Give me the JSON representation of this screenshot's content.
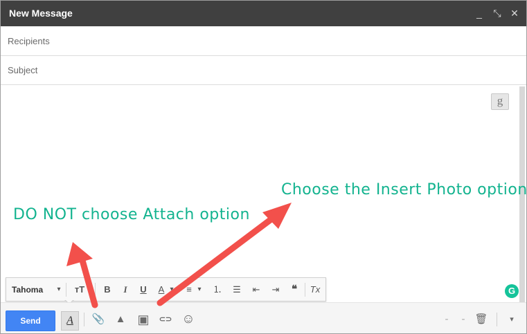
{
  "window": {
    "title": "New Message",
    "controls": {
      "minimize": "_",
      "expand": "⤡",
      "close": "✕"
    }
  },
  "fields": {
    "recipients_placeholder": "Recipients",
    "subject_placeholder": "Subject"
  },
  "formatting": {
    "font": "Tahoma",
    "dropdown": "▾",
    "size": "тT",
    "bold": "B",
    "italic": "I",
    "underline": "U",
    "text_color": "A",
    "align": "≡",
    "numbered": "⒈",
    "bulleted": "☰",
    "indent_less": "⇤",
    "indent_more": "⇥",
    "quote": "❝",
    "remove": "Tx"
  },
  "toolbar": {
    "send_label": "Send",
    "format_label": "A",
    "attach_glyph": "📎",
    "drive_glyph": "▲",
    "photo_glyph": "▣",
    "link_glyph": "⊂⊃",
    "emoji_glyph": "☺",
    "dash1": "-",
    "dash2": "-",
    "trash_glyph": "🗑",
    "more_glyph": "▾"
  },
  "grammarly": {
    "g_label": "g",
    "circle_label": "G"
  },
  "annotations": {
    "left": "DO NOT choose Attach option",
    "right": "Choose the Insert Photo option"
  },
  "colors": {
    "titlebar": "#404040",
    "send": "#4285f4",
    "annotation": "#13b38f",
    "arrow": "#f2504b",
    "grammarly": "#15c39a"
  }
}
